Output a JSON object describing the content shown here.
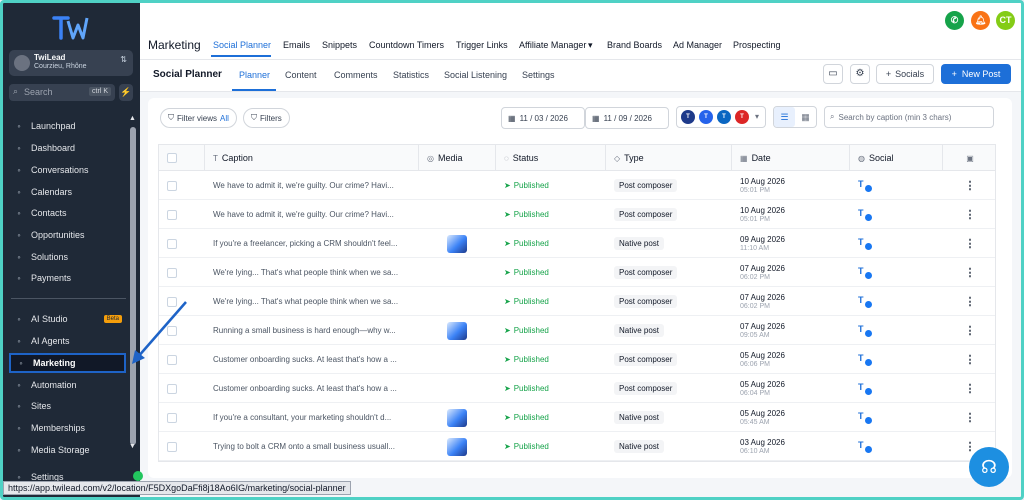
{
  "account": {
    "name": "TwiLead",
    "location": "Courzieu, Rhône"
  },
  "sidebar": {
    "search_placeholder": "Search",
    "search_kbd": "ctrl K",
    "items": [
      {
        "label": "Launchpad",
        "icon": "rocket-icon"
      },
      {
        "label": "Dashboard",
        "icon": "dashboard-icon"
      },
      {
        "label": "Conversations",
        "icon": "chat-icon"
      },
      {
        "label": "Calendars",
        "icon": "calendar-icon"
      },
      {
        "label": "Contacts",
        "icon": "contacts-icon"
      },
      {
        "label": "Opportunities",
        "icon": "opportunities-icon"
      },
      {
        "label": "Solutions",
        "icon": "solutions-icon"
      },
      {
        "label": "Payments",
        "icon": "payments-icon"
      },
      {
        "label": "AI Studio",
        "icon": "ai-studio-icon",
        "badge": "Beta"
      },
      {
        "label": "AI Agents",
        "icon": "ai-agents-icon"
      },
      {
        "label": "Marketing",
        "icon": "send-icon",
        "active": true
      },
      {
        "label": "Automation",
        "icon": "automation-icon"
      },
      {
        "label": "Sites",
        "icon": "sites-icon"
      },
      {
        "label": "Memberships",
        "icon": "memberships-icon"
      },
      {
        "label": "Media Storage",
        "icon": "media-storage-icon"
      },
      {
        "label": "Settings",
        "icon": "gear-icon"
      }
    ]
  },
  "header": {
    "title": "Marketing",
    "tabs": [
      {
        "label": "Social Planner",
        "active": true
      },
      {
        "label": "Emails"
      },
      {
        "label": "Snippets"
      },
      {
        "label": "Countdown Timers"
      },
      {
        "label": "Trigger Links"
      },
      {
        "label": "Affiliate Manager"
      },
      {
        "label": "Brand Boards"
      },
      {
        "label": "Ad Manager"
      },
      {
        "label": "Prospecting"
      }
    ],
    "avatar_initials": "CT"
  },
  "subheader": {
    "title": "Social Planner",
    "tabs": [
      {
        "label": "Planner",
        "active": true
      },
      {
        "label": "Content"
      },
      {
        "label": "Comments"
      },
      {
        "label": "Statistics"
      },
      {
        "label": "Social Listening"
      },
      {
        "label": "Settings"
      }
    ],
    "socials_label": "Socials",
    "new_post_label": "New Post"
  },
  "filters": {
    "filter_views_label": "Filter views",
    "filter_views_value": "All",
    "filters_label": "Filters",
    "date_from": "11 / 03 / 2026",
    "date_to": "11 / 09 / 2026",
    "search_placeholder": "Search by caption (min 3 chars)"
  },
  "table": {
    "columns": [
      "Caption",
      "Media",
      "Status",
      "Type",
      "Date",
      "Social"
    ],
    "rows": [
      {
        "caption": "We have to admit it, we're guilty. Our crime? Havi...",
        "media": false,
        "status": "Published",
        "type": "Post composer",
        "date": "10 Aug 2026",
        "time": "05:01 PM"
      },
      {
        "caption": "We have to admit it, we're guilty. Our crime? Havi...",
        "media": false,
        "status": "Published",
        "type": "Post composer",
        "date": "10 Aug 2026",
        "time": "05:01 PM"
      },
      {
        "caption": "If you're a freelancer, picking a CRM shouldn't feel...",
        "media": true,
        "status": "Published",
        "type": "Native post",
        "date": "09 Aug 2026",
        "time": "11:10 AM"
      },
      {
        "caption": "We're lying... That's what people think when we sa...",
        "media": false,
        "status": "Published",
        "type": "Post composer",
        "date": "07 Aug 2026",
        "time": "06:02 PM"
      },
      {
        "caption": "We're lying... That's what people think when we sa...",
        "media": false,
        "status": "Published",
        "type": "Post composer",
        "date": "07 Aug 2026",
        "time": "06:02 PM"
      },
      {
        "caption": "Running a small business is hard enough—why w...",
        "media": true,
        "status": "Published",
        "type": "Native post",
        "date": "07 Aug 2026",
        "time": "09:05 AM"
      },
      {
        "caption": "Customer onboarding sucks. At least that's how a ...",
        "media": false,
        "status": "Published",
        "type": "Post composer",
        "date": "05 Aug 2026",
        "time": "06:06 PM"
      },
      {
        "caption": "Customer onboarding sucks. At least that's how a ...",
        "media": false,
        "status": "Published",
        "type": "Post composer",
        "date": "05 Aug 2026",
        "time": "06:04 PM"
      },
      {
        "caption": "If you're a consultant, your marketing shouldn't d...",
        "media": true,
        "status": "Published",
        "type": "Native post",
        "date": "05 Aug 2026",
        "time": "05:45 AM"
      },
      {
        "caption": "Trying to bolt a CRM onto a small business usuall...",
        "media": true,
        "status": "Published",
        "type": "Native post",
        "date": "03 Aug 2026",
        "time": "06:10 AM"
      }
    ]
  },
  "url": "https://app.twilead.com/v2/location/F5DXgoDaFfi8j18Ao6IG/marketing/social-planner",
  "colors": {
    "accent": "#1d6fd8",
    "sidebar": "#1f2937",
    "published": "#16a34a"
  }
}
